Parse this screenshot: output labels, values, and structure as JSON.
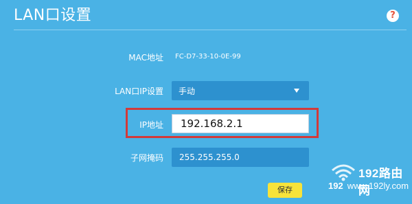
{
  "header": {
    "title": "LAN口设置",
    "help_icon": "help-icon",
    "help_symbol": "?"
  },
  "form": {
    "mac": {
      "label": "MAC地址",
      "value": "FC-D7-33-10-0E-99"
    },
    "lan_ip_mode": {
      "label": "LAN口IP设置",
      "value": "手动"
    },
    "ip": {
      "label": "IP地址",
      "value": "192.168.2.1"
    },
    "mask": {
      "label": "子网掩码",
      "value": "255.255.255.0"
    },
    "save_label": "保存"
  },
  "watermark": {
    "brand": "192路由网",
    "prefix": "192",
    "url": "www.192ly.com"
  },
  "colors": {
    "background": "#4ab2e5",
    "field_dark": "#2d91cf",
    "highlight": "#d23a3a",
    "save_button": "#f7e33a"
  }
}
